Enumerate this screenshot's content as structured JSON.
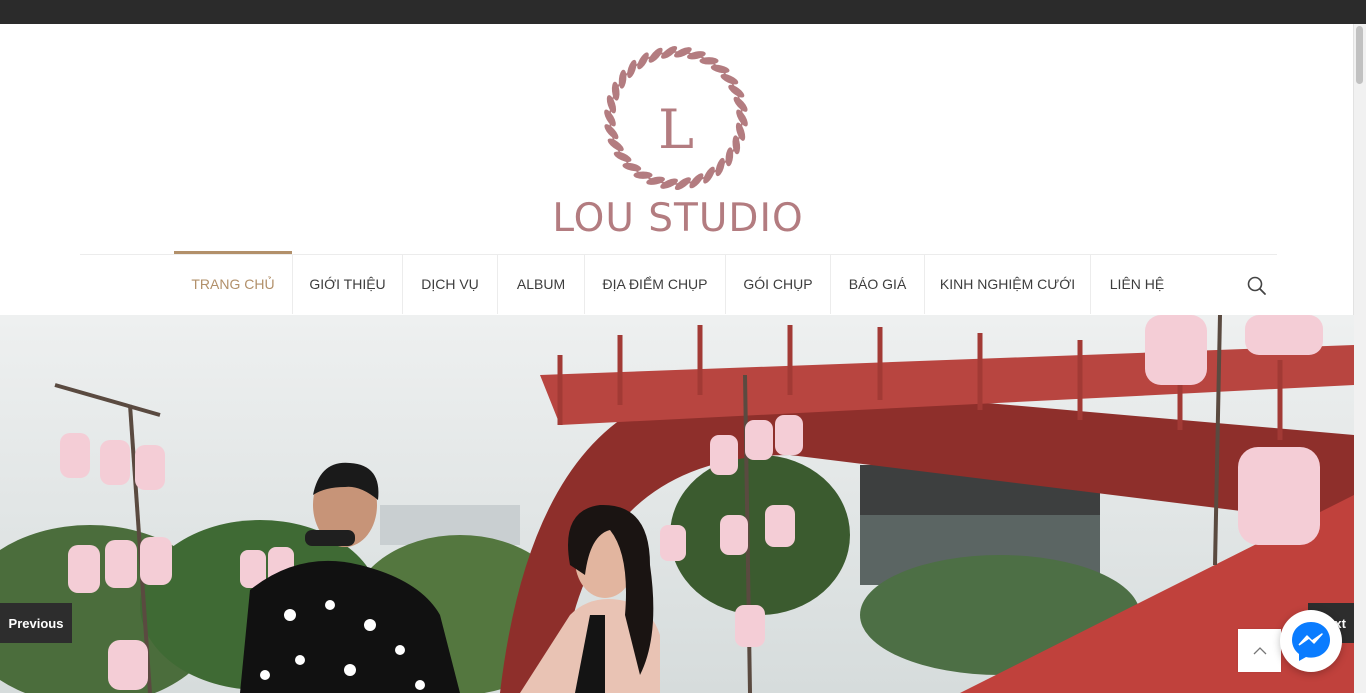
{
  "brand": {
    "initial": "L",
    "name": "LOU STUDIO",
    "color": "#b37c80"
  },
  "nav": {
    "items": [
      {
        "label": "TRANG CHỦ",
        "active": true
      },
      {
        "label": "GIỚI THIỆU"
      },
      {
        "label": "DỊCH VỤ"
      },
      {
        "label": "ALBUM"
      },
      {
        "label": "ĐỊA ĐIỂM CHỤP"
      },
      {
        "label": "GÓI CHỤP"
      },
      {
        "label": "BÁO GIÁ"
      },
      {
        "label": "KINH NGHIỆM CƯỚI"
      },
      {
        "label": "LIÊN HỆ"
      }
    ],
    "active_color": "#b2906a",
    "search_icon": "search-icon"
  },
  "slider": {
    "prev_label": "Previous",
    "next_label": "Next"
  },
  "widgets": {
    "back_to_top_icon": "chevron-up-icon",
    "messenger_icon": "messenger-icon",
    "messenger_color": "#0a7cff"
  }
}
